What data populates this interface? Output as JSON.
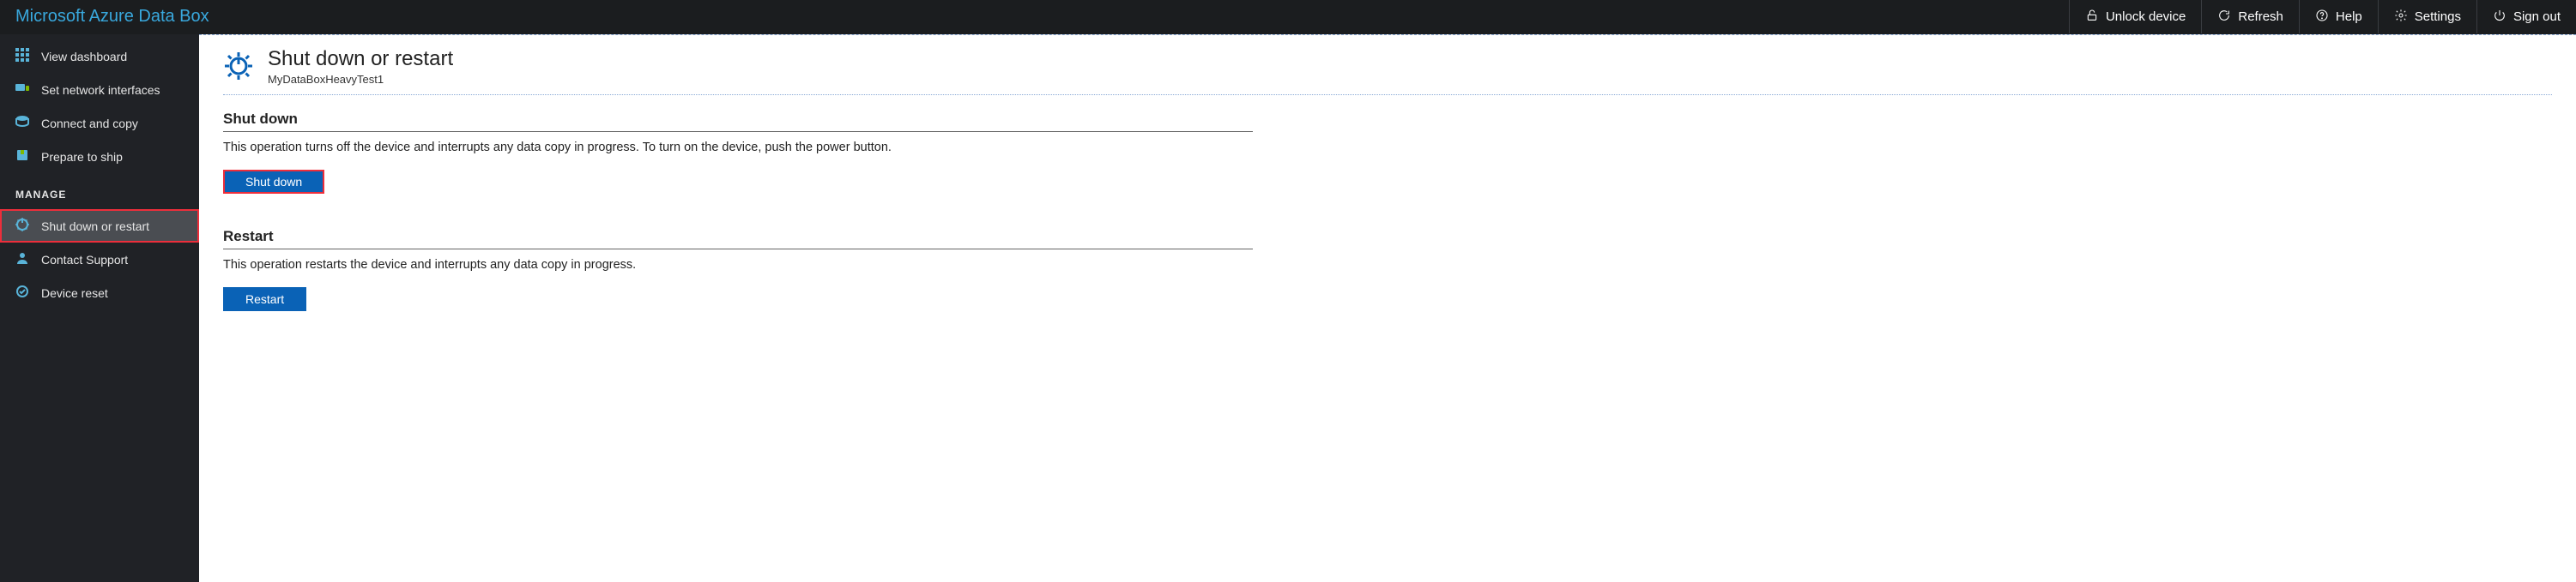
{
  "brand": "Microsoft Azure Data Box",
  "topbar": {
    "unlock": "Unlock device",
    "refresh": "Refresh",
    "help": "Help",
    "settings": "Settings",
    "signout": "Sign out"
  },
  "sidebar": {
    "view_dashboard": "View dashboard",
    "set_network": "Set network interfaces",
    "connect_copy": "Connect and copy",
    "prepare_ship": "Prepare to ship",
    "manage_label": "MANAGE",
    "shutdown_restart": "Shut down or restart",
    "contact_support": "Contact Support",
    "device_reset": "Device reset"
  },
  "page": {
    "title": "Shut down or restart",
    "subtitle": "MyDataBoxHeavyTest1"
  },
  "shutdown": {
    "title": "Shut down",
    "desc": "This operation turns off the device and interrupts any data copy in progress. To turn on the device, push the power button.",
    "button": "Shut down"
  },
  "restart": {
    "title": "Restart",
    "desc": "This operation restarts the device and interrupts any data copy in progress.",
    "button": "Restart"
  }
}
